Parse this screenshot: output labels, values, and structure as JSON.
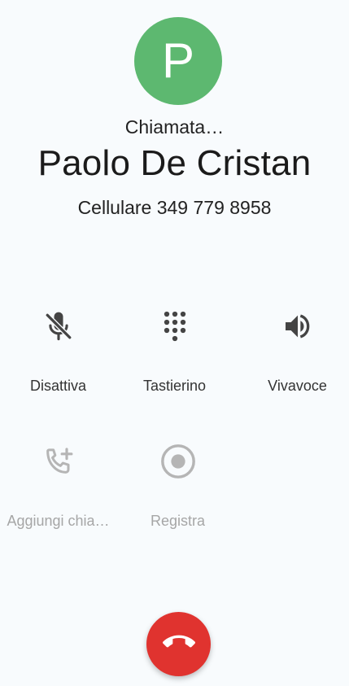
{
  "contact": {
    "initial": "P",
    "status": "Chiamata…",
    "name": "Paolo De Cristan",
    "number": "Cellulare 349 779 8958"
  },
  "controls": {
    "mute": {
      "label": "Disattiva",
      "icon": "mic-off-icon"
    },
    "keypad": {
      "label": "Tastierino",
      "icon": "dialpad-icon"
    },
    "speaker": {
      "label": "Vivavoce",
      "icon": "volume-icon"
    },
    "add_call": {
      "label": "Aggiungi chia…",
      "icon": "add-call-icon",
      "enabled": false
    },
    "record": {
      "label": "Registra",
      "icon": "record-icon",
      "enabled": false
    }
  },
  "end_call": {
    "icon": "hang-up-icon"
  },
  "colors": {
    "avatar": "#5db870",
    "end_call": "#e0332f",
    "background": "#f8fbfd"
  }
}
